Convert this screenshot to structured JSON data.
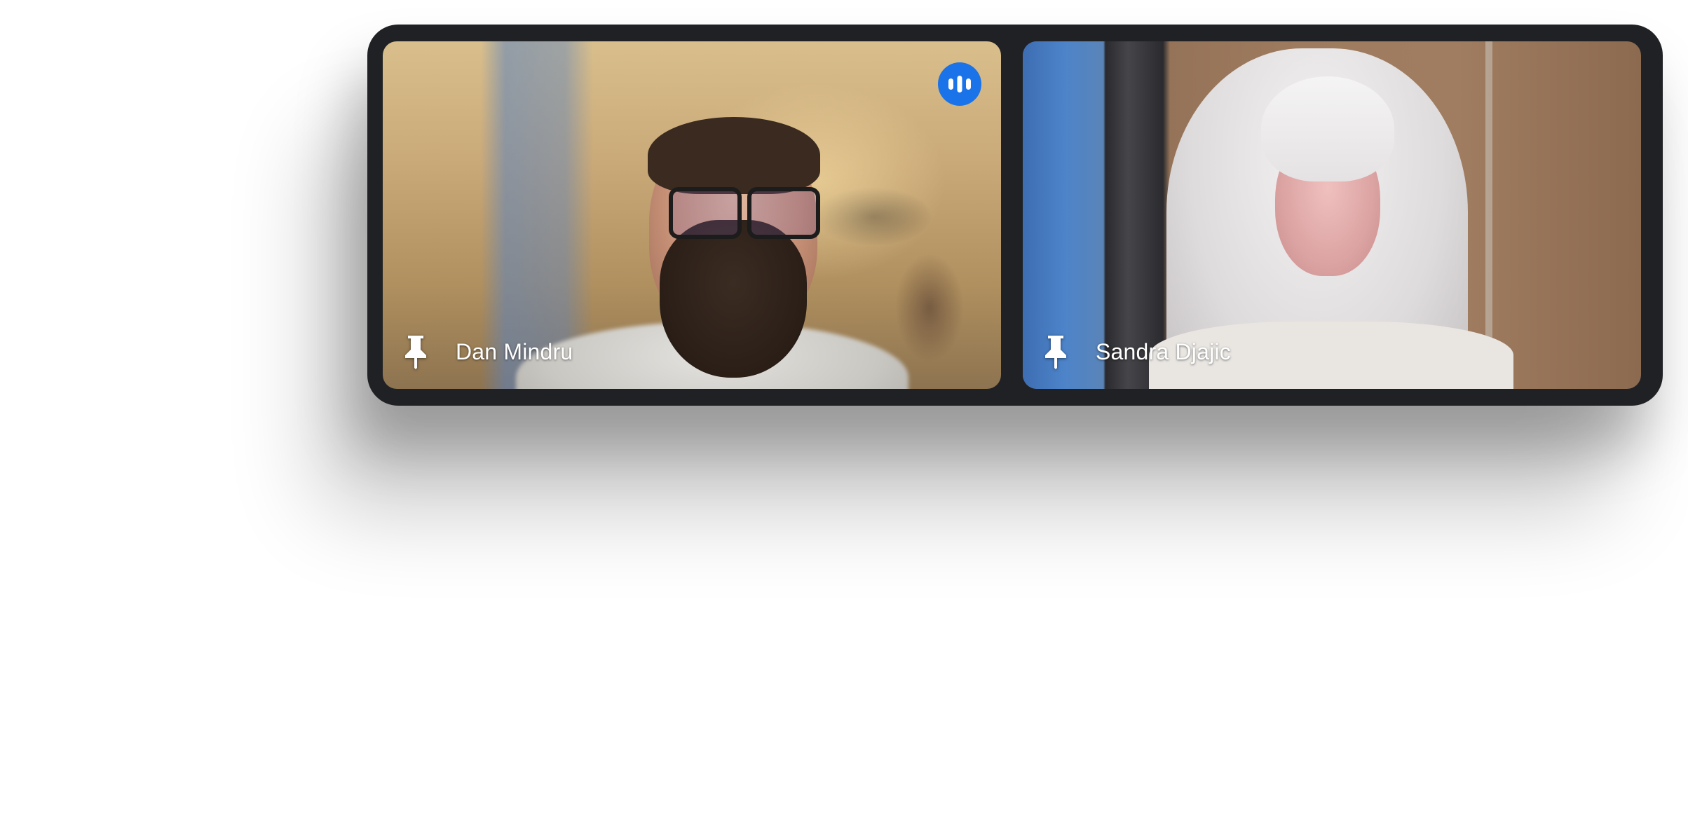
{
  "participants": [
    {
      "name": "Dan Mindru",
      "pin_icon": "pin-icon",
      "speaking": true,
      "speaking_icon": "audio-level-icon"
    },
    {
      "name": "Sandra Djajic",
      "pin_icon": "pin-icon",
      "speaking": false
    }
  ],
  "colors": {
    "bar_background": "#202124",
    "speaking_indicator": "#1a73e8",
    "label_text": "#ffffff"
  }
}
